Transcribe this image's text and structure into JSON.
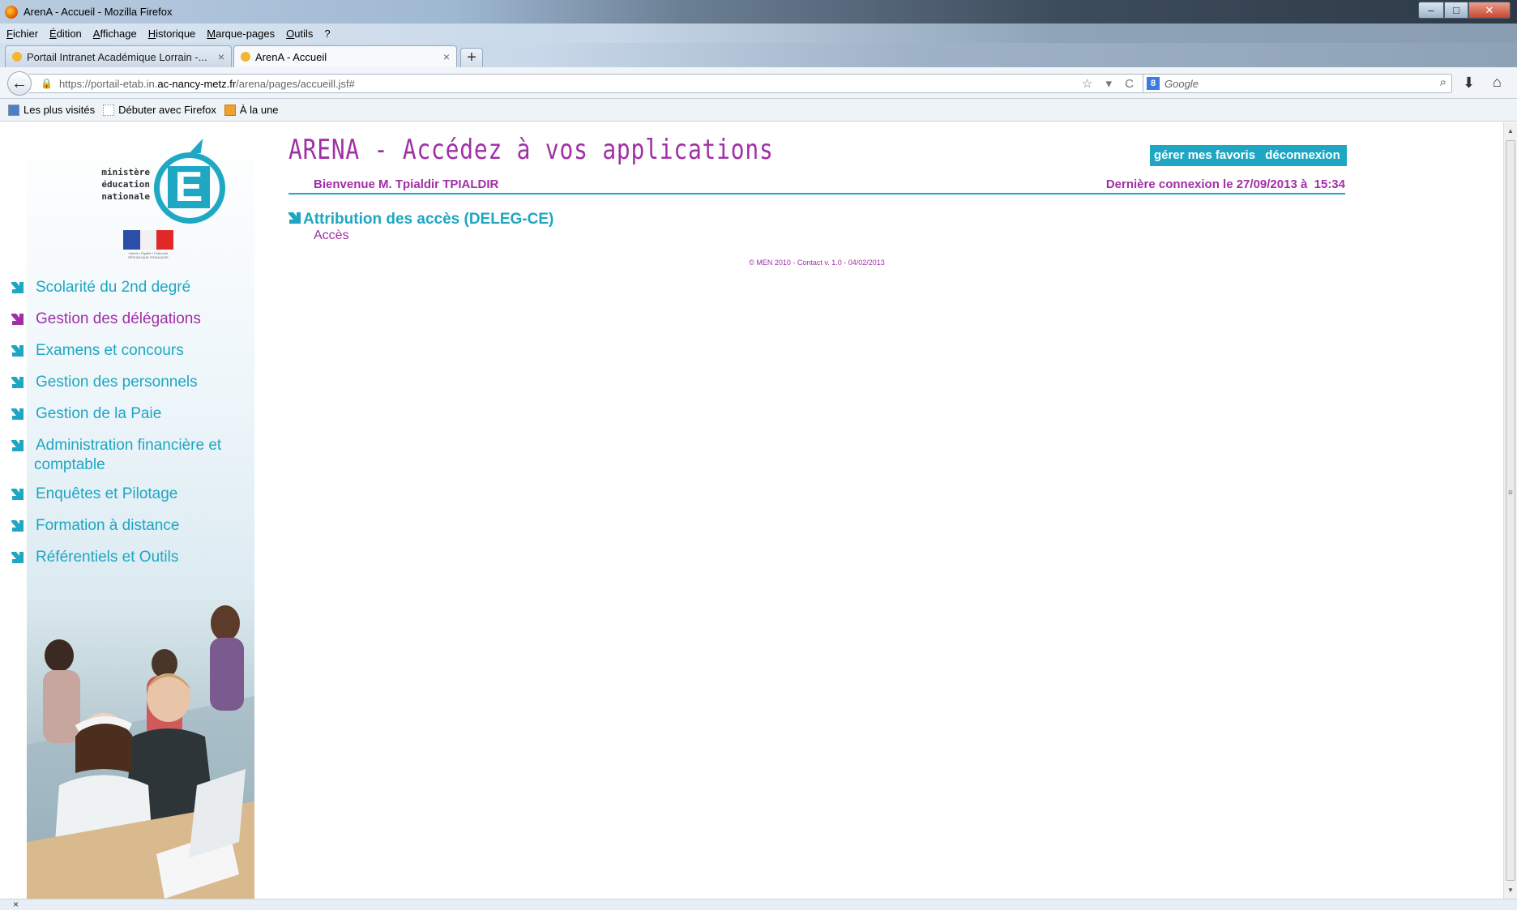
{
  "window": {
    "title": "ArenA - Accueil - Mozilla Firefox",
    "controls": {
      "minimize": "–",
      "maximize": "□",
      "close": "✕"
    }
  },
  "menu": [
    "Fichier",
    "Édition",
    "Affichage",
    "Historique",
    "Marque-pages",
    "Outils",
    "?"
  ],
  "tabs": [
    {
      "label": "Portail Intranet Académique Lorrain -...",
      "close": "×"
    },
    {
      "label": "ArenA - Accueil",
      "close": "×"
    }
  ],
  "new_tab": "+",
  "address": {
    "prefix": "https://portail-etab.in.",
    "domain": "ac-nancy-metz.fr",
    "path": "/arena/pages/accueill.jsf#",
    "right_icons": "☆ ▾ C"
  },
  "search": {
    "placeholder": "Google",
    "engine": "8"
  },
  "bookmarks": [
    "Les plus visités",
    "Débuter avec Firefox",
    "À la une"
  ],
  "logo": {
    "line1": "ministère",
    "line2": "éducation",
    "line3": "nationale",
    "letter": "E",
    "caption": "Liberté • Égalité • Fraternité RÉPUBLIQUE FRANÇAISE"
  },
  "sidebar_nav": [
    {
      "label": "Scolarité du 2nd degré",
      "selected": false
    },
    {
      "label": "Gestion des délégations",
      "selected": true
    },
    {
      "label": "Examens et concours",
      "selected": false
    },
    {
      "label": "Gestion des personnels",
      "selected": false
    },
    {
      "label": "Gestion de la Paie",
      "selected": false
    },
    {
      "label": "Administration financière et",
      "cont": "comptable",
      "selected": false
    },
    {
      "label": "Enquêtes et Pilotage",
      "selected": false
    },
    {
      "label": "Formation à distance",
      "selected": false
    },
    {
      "label": "Référentiels et Outils",
      "selected": false
    }
  ],
  "main": {
    "title": "ARENA - Accédez à vos applications",
    "btn_favorites": "gérer mes favoris",
    "btn_logout": "déconnexion",
    "welcome": "Bienvenue M. Tpialdir TPIALDIR",
    "last_connection": "Dernière connexion le 27/09/2013 à  15:34",
    "app_title": "Attribution des accès (DELEG-CE)",
    "app_link": "Accès",
    "footer": {
      "copyright": "© MEN 2010 - ",
      "contact": "Contact",
      "version": " v. 1.0 - 04/02/2013"
    }
  },
  "statusbar": {
    "close": "×"
  },
  "colors": {
    "accent_cyan": "#1ea6c3",
    "accent_purple": "#a02fa6"
  }
}
